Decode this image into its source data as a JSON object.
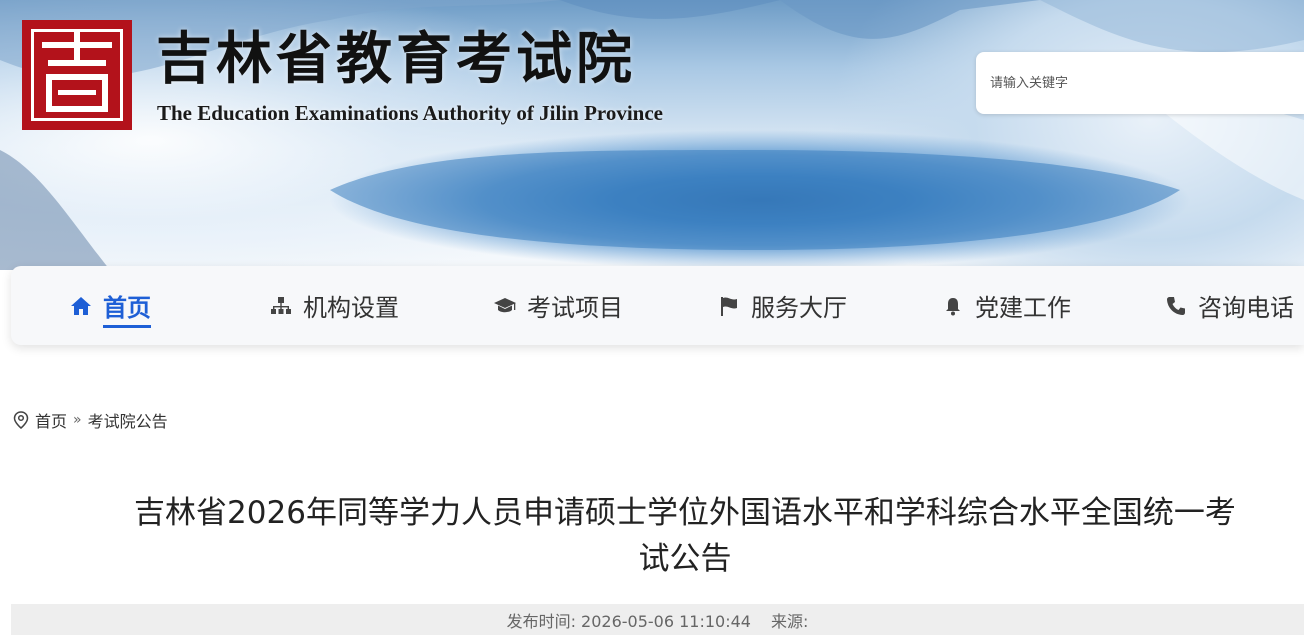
{
  "header": {
    "logo_cn": "吉林省教育考试院",
    "logo_en": "The Education Examinations Authority of Jilin Province",
    "search_placeholder": "请输入关键字"
  },
  "nav": {
    "items": [
      {
        "label": "首页",
        "icon": "home-icon",
        "active": true
      },
      {
        "label": "机构设置",
        "icon": "org-chart-icon",
        "active": false
      },
      {
        "label": "考试项目",
        "icon": "graduation-cap-icon",
        "active": false
      },
      {
        "label": "服务大厅",
        "icon": "flag-icon",
        "active": false
      },
      {
        "label": "党建工作",
        "icon": "bell-icon",
        "active": false
      },
      {
        "label": "咨询电话",
        "icon": "phone-icon",
        "active": false
      }
    ]
  },
  "breadcrumb": {
    "home": "首页",
    "current": "考试院公告"
  },
  "article": {
    "title_line1": "吉林省2026年同等学力人员申请硕士学位外国语水平和学科综合水平全国统一考",
    "title_line2": "试公告",
    "publish_time": "发布时间: 2026-05-06 11:10:44",
    "source": "来源:"
  },
  "colors": {
    "accent": "#1e5fd6",
    "seal_red": "#b3121b",
    "nav_bg": "#f7f8fa"
  }
}
